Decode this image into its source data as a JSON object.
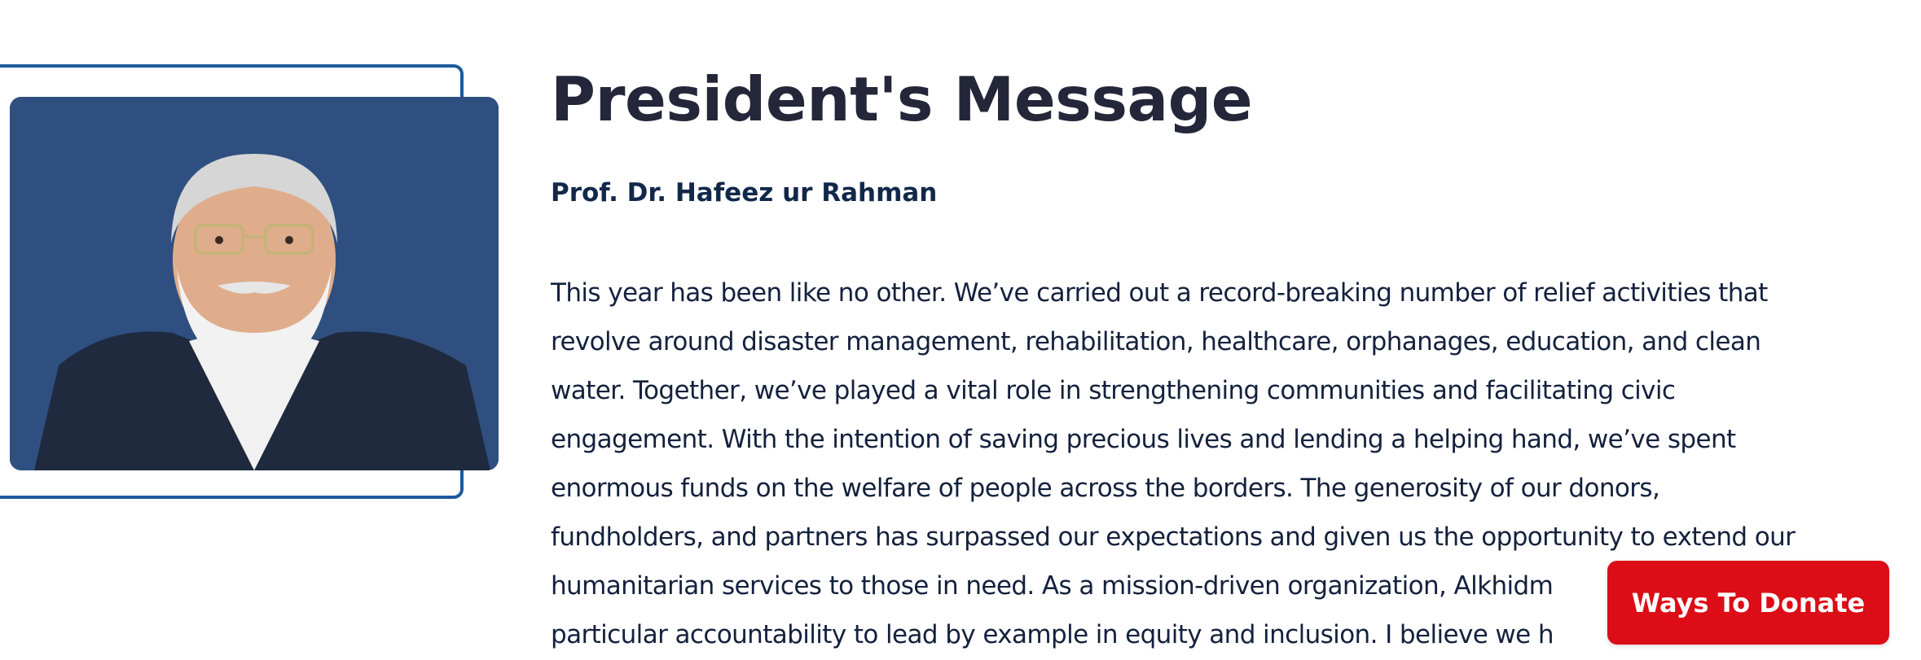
{
  "section": {
    "title": "President's Message",
    "author": "Prof. Dr. Hafeez ur Rahman",
    "body_lines": [
      "This year has been like no other. We’ve carried out a record-breaking number of relief activities that",
      "revolve around disaster management, rehabilitation, healthcare, orphanages, education, and clean",
      "water. Together, we’ve played a vital role in strengthening communities and facilitating civic",
      "engagement. With the intention of saving precious lives and lending a helping hand, we’ve spent",
      "enormous funds on the welfare of people across the borders. The generosity of our donors,",
      "fundholders, and partners has surpassed our expectations and given us the opportunity to extend our",
      "humanitarian services to those in need. As a mission-driven organization, Alkhidm",
      "particular accountability to lead by example in equity and inclusion. I believe we h"
    ]
  },
  "cta": {
    "donate_label": "Ways To Donate"
  },
  "colors": {
    "frame_border": "#1d5a9c",
    "portrait_background": "#2f4f80",
    "title": "#24263a",
    "body": "#14213d",
    "donate_background": "#dc0d16"
  }
}
